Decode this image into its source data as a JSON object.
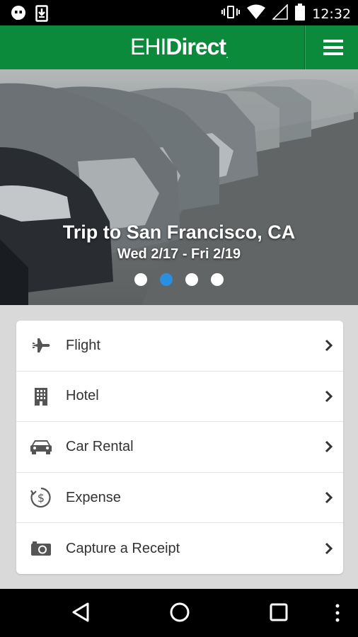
{
  "status_bar": {
    "time": "12:32",
    "left_icons": [
      "hangouts-icon",
      "download-icon"
    ],
    "right_icons": [
      "vibrate-icon",
      "wifi-icon",
      "cell-signal-icon",
      "battery-icon"
    ]
  },
  "app_bar": {
    "brand_part1": "EHI",
    "brand_part2": "Direct",
    "brand_mark": ".",
    "menu_icon": "hamburger-menu-icon",
    "color": "#0a8a3a"
  },
  "hero": {
    "title": "Trip to San Francisco, CA",
    "dates": "Wed 2/17 - Fri 2/19",
    "carousel": {
      "count": 4,
      "active_index": 1,
      "active_color": "#2b8fe0"
    }
  },
  "menu": [
    {
      "label": "Flight",
      "icon": "airplane-icon"
    },
    {
      "label": "Hotel",
      "icon": "building-icon"
    },
    {
      "label": "Car Rental",
      "icon": "car-icon"
    },
    {
      "label": "Expense",
      "icon": "dollar-cycle-icon"
    },
    {
      "label": "Capture a Receipt",
      "icon": "camera-icon"
    }
  ],
  "nav_bar": {
    "buttons": [
      "back-icon",
      "home-icon",
      "recents-icon",
      "overflow-icon"
    ]
  }
}
